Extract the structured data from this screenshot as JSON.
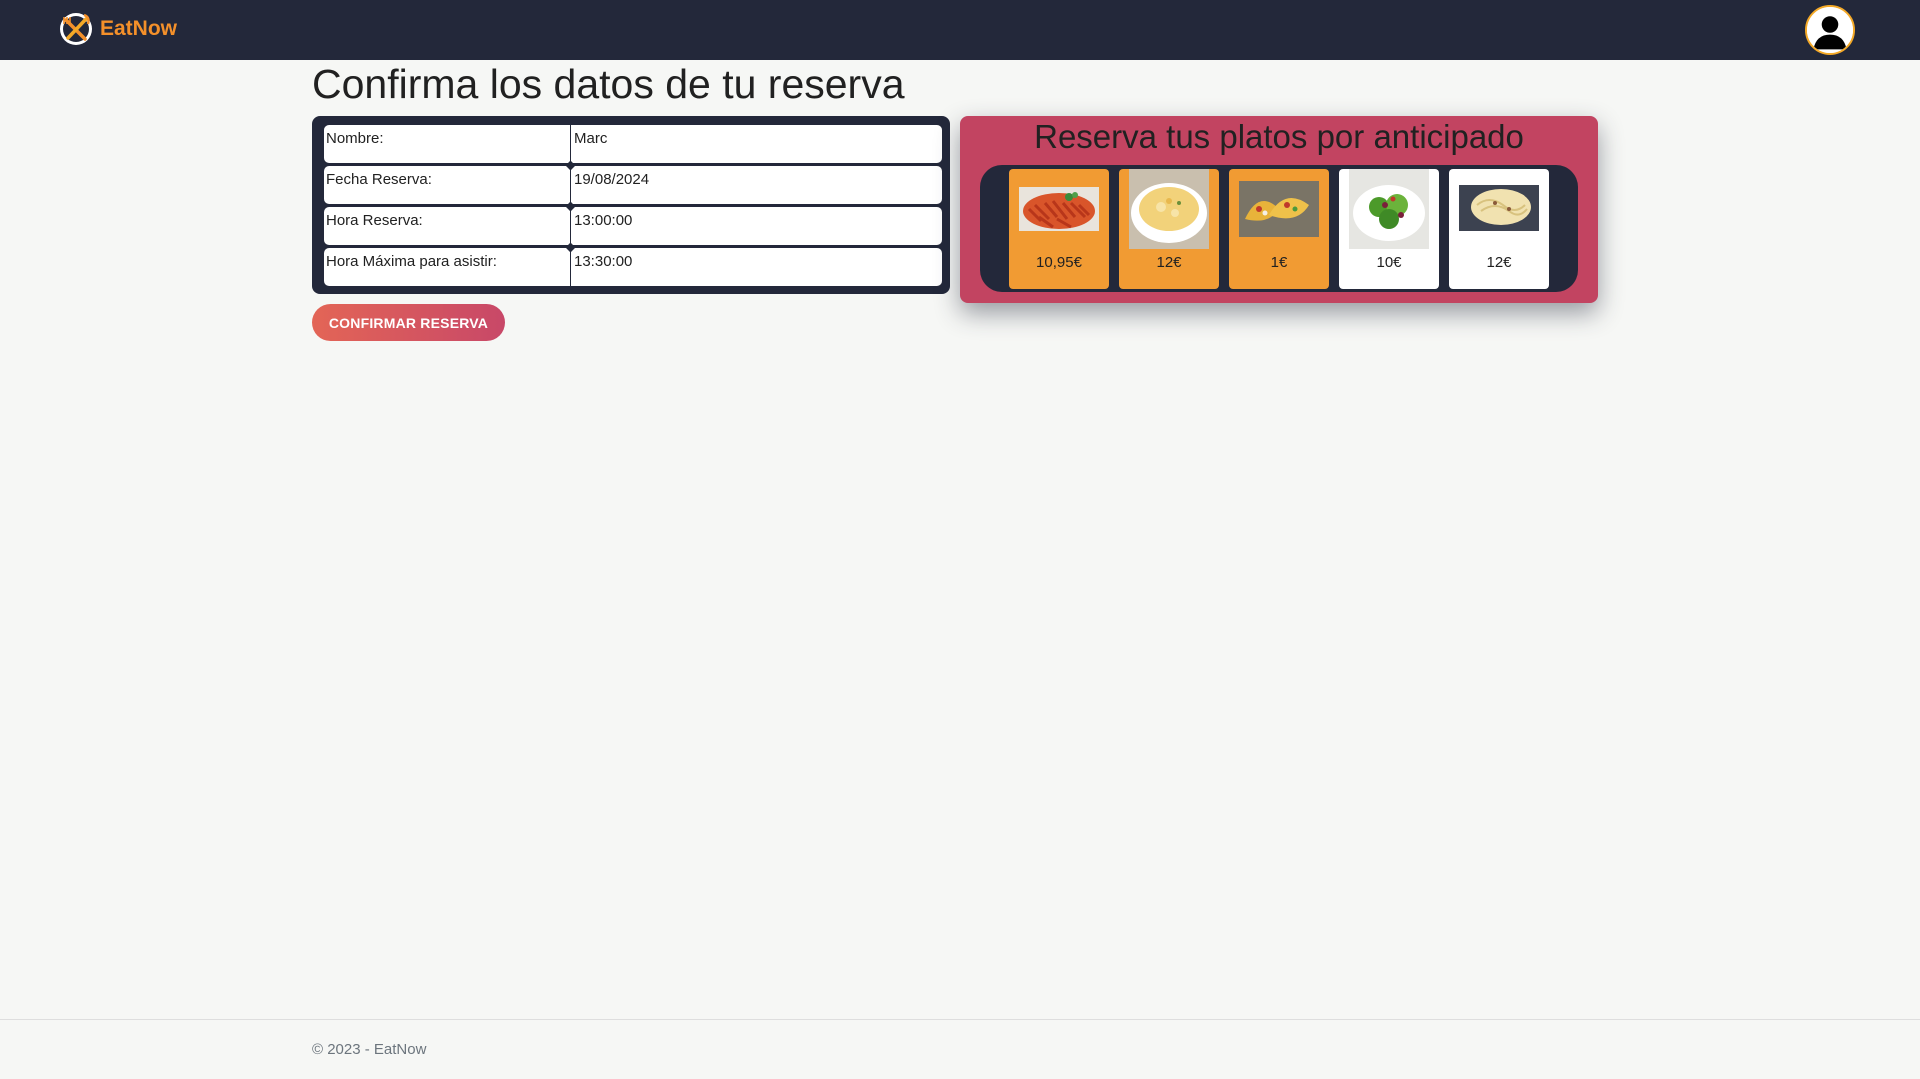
{
  "navbar": {
    "brand_name": "EatNow",
    "logo_icon": "eatnow-logo-icon",
    "avatar_icon": "user-avatar-icon",
    "colors": {
      "background": "#23283a",
      "brand": "#f4902a"
    }
  },
  "page": {
    "title": "Confirma los datos de tu reserva"
  },
  "reservation": {
    "rows": [
      {
        "label": "Nombre:",
        "value": "Marc"
      },
      {
        "label": "Fecha Reserva:",
        "value": "19/08/2024"
      },
      {
        "label": "Hora Reserva:",
        "value": "13:00:00"
      },
      {
        "label": "Hora Máxima para asistir:",
        "value": "13:30:00"
      }
    ]
  },
  "confirm_button": {
    "label": "CONFIRMAR RESERVA"
  },
  "preorder": {
    "title": "Reserva tus platos por anticipado",
    "colors": {
      "panel": "#c24461",
      "strip": "#23283a",
      "selected": "#f19b33",
      "unselected": "#ffffff"
    },
    "dishes": [
      {
        "price": "10,95€",
        "image": "pasta-penne-image",
        "selected": true
      },
      {
        "price": "12€",
        "image": "soup-bowl-image",
        "selected": true
      },
      {
        "price": "1€",
        "image": "tacos-image",
        "selected": true
      },
      {
        "price": "10€",
        "image": "salad-image",
        "selected": false
      },
      {
        "price": "12€",
        "image": "pasta-carbonara-image",
        "selected": false
      }
    ]
  },
  "footer": {
    "text": "© 2023 - EatNow"
  }
}
